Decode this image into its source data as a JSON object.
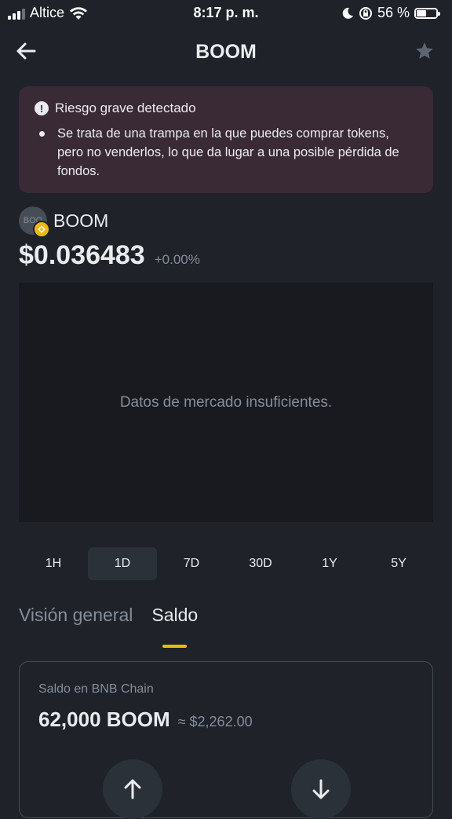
{
  "status_bar": {
    "carrier": "Altice",
    "time": "8:17 p. m.",
    "battery_text": "56 %",
    "battery_level": 0.56
  },
  "nav": {
    "title": "BOOM",
    "back_icon": "arrow-left-icon",
    "favorite_icon": "star-icon"
  },
  "risk": {
    "title": "Riesgo grave detectado",
    "description": "Se trata de una trampa en la que puedes comprar tokens, pero no venderlos, lo que da lugar a una posible pérdida de fondos.",
    "icon": "exclamation-icon"
  },
  "token": {
    "logo_text": "BOO",
    "name": "BOOM",
    "price": "$0.036483",
    "change": "+0.00%"
  },
  "chart": {
    "empty_message": "Datos de mercado insuficientes."
  },
  "ranges": [
    "1H",
    "1D",
    "7D",
    "30D",
    "1Y",
    "5Y"
  ],
  "active_range": "1D",
  "tabs": {
    "overview": "Visión general",
    "balance": "Saldo"
  },
  "balance": {
    "label": "Saldo en BNB Chain",
    "amount": "62,000 BOOM",
    "usd": "≈ $2,262.00",
    "send_icon": "arrow-up-icon",
    "receive_icon": "arrow-down-icon"
  },
  "colors": {
    "background": "#1f2229",
    "accent": "#f0b90b",
    "risk_background": "#3a2a36"
  }
}
